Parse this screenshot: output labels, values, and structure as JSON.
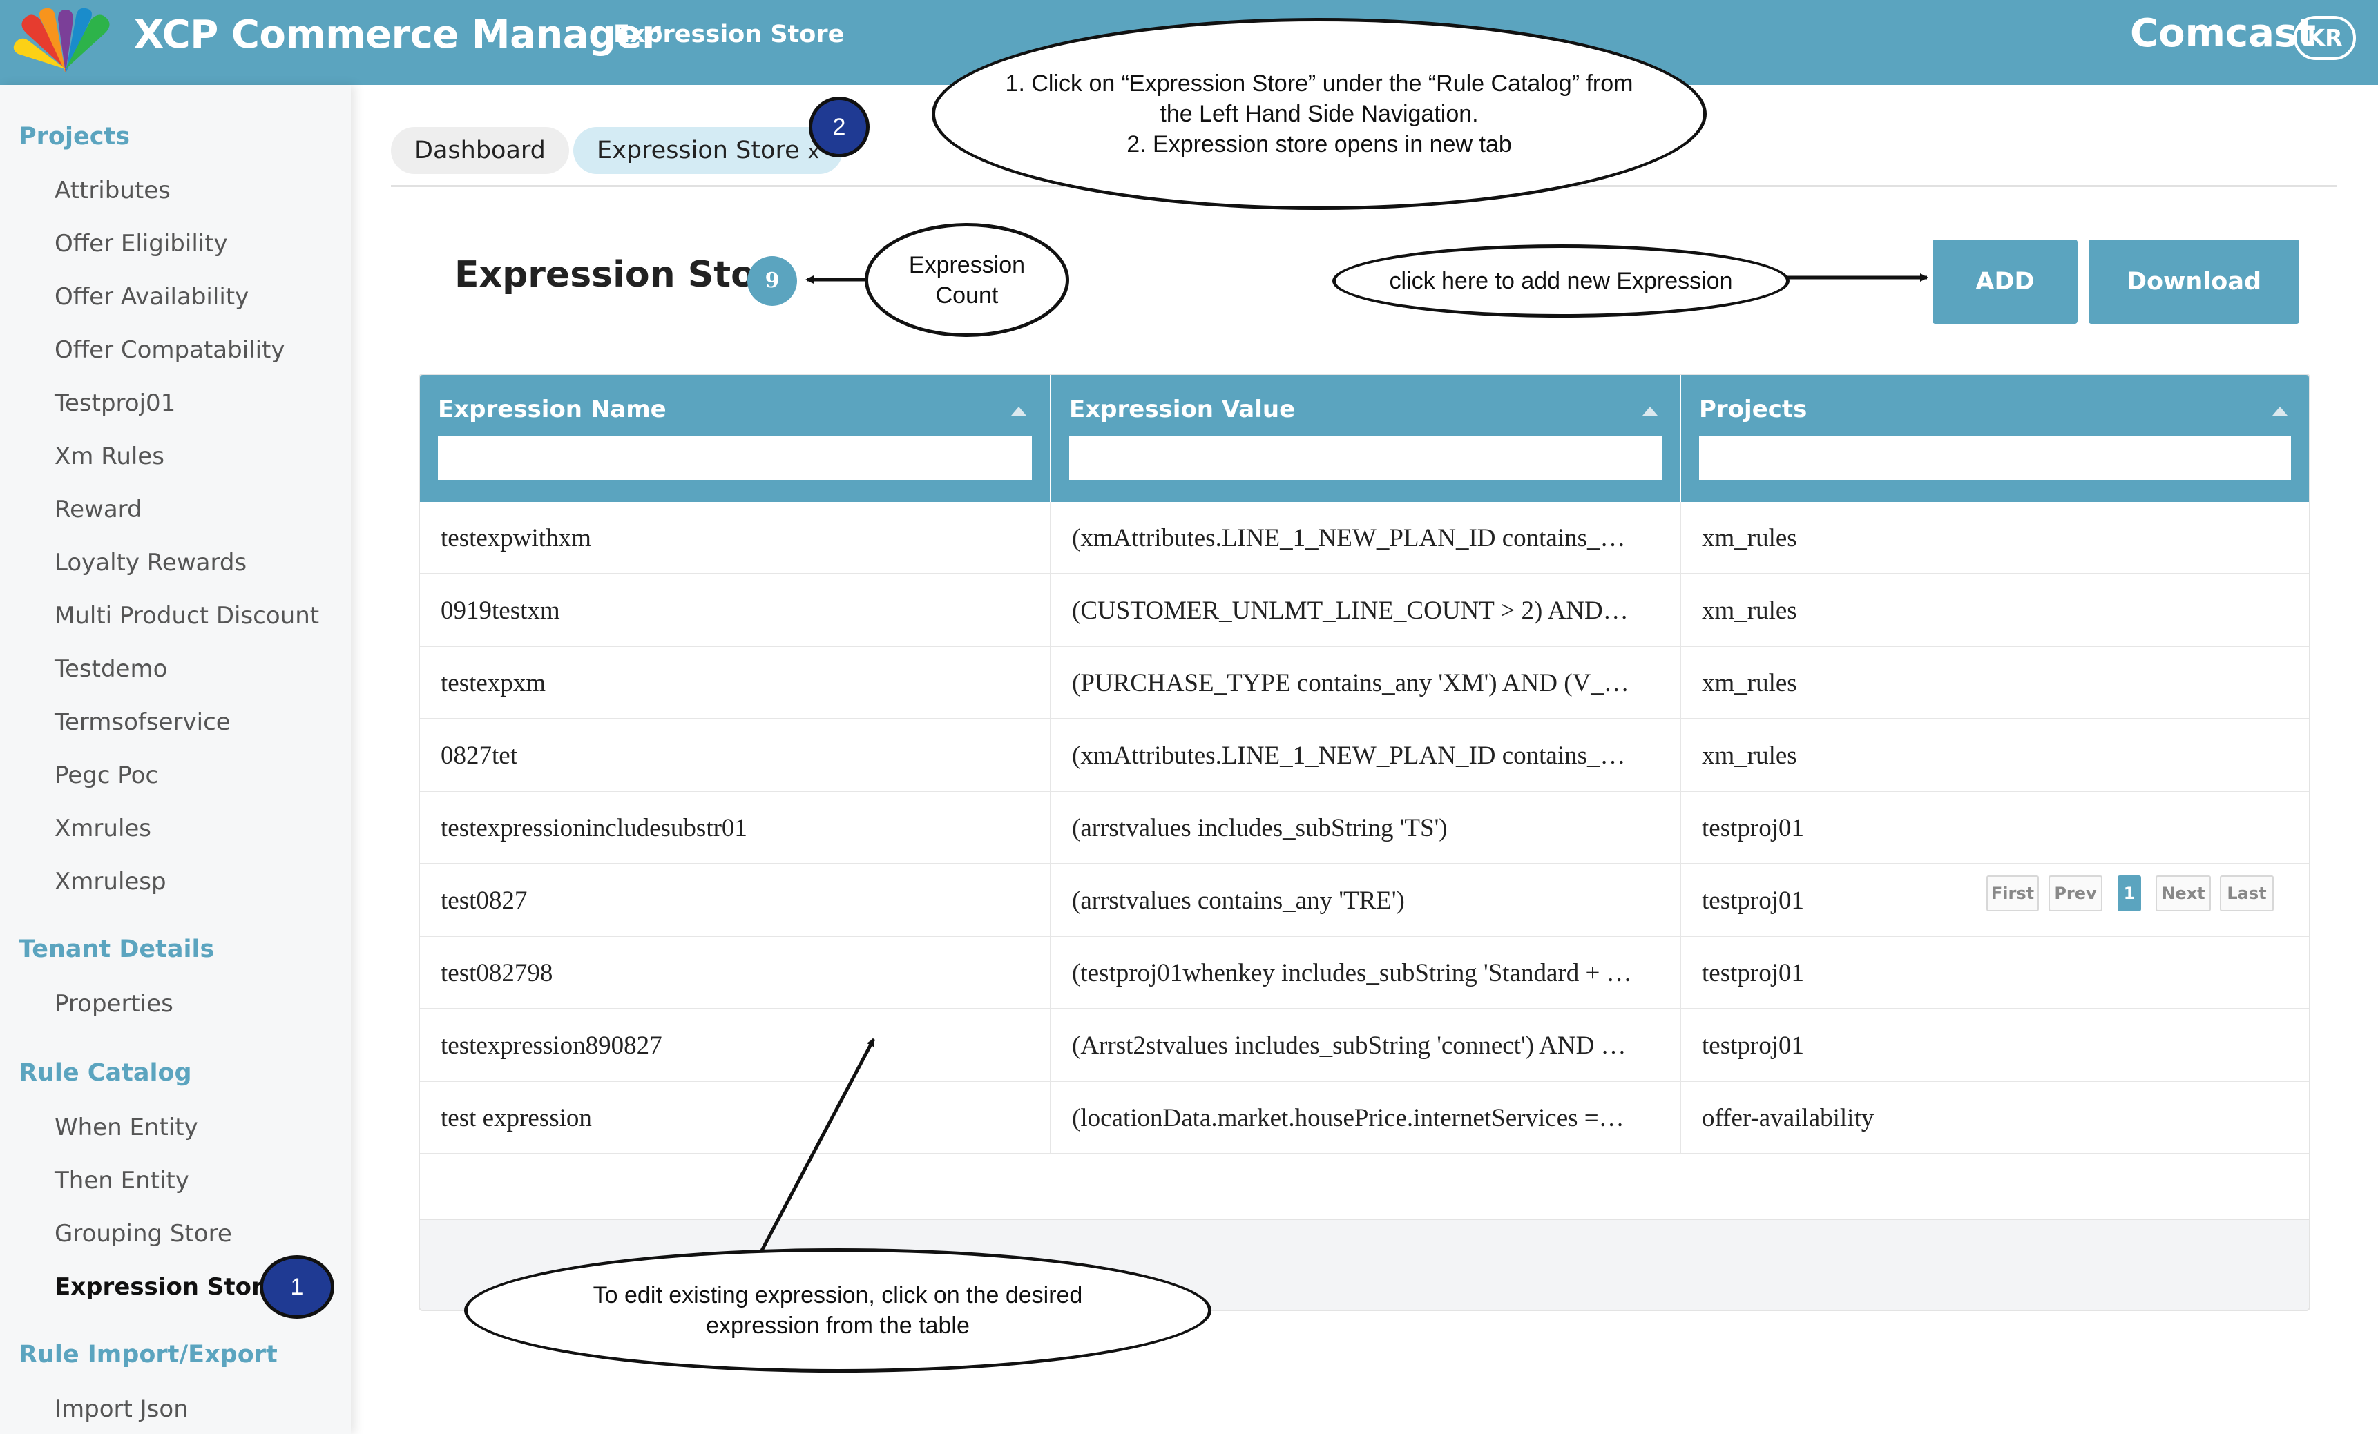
{
  "header": {
    "app_title": "XCP Commerce Manager",
    "active_section": "Expression Store",
    "brand": "Comcast",
    "user_initials": "KR",
    "logo_icon": "peacock-logo-icon"
  },
  "sidebar": {
    "sections": [
      {
        "title": "Projects",
        "items": [
          "Attributes",
          "Offer Eligibility",
          "Offer Availability",
          "Offer Compatability",
          "Testproj01",
          "Xm Rules",
          "Reward",
          "Loyalty Rewards",
          "Multi Product Discount",
          "Testdemo",
          "Termsofservice",
          "Pegc Poc",
          "Xmrules",
          "Xmrulesp"
        ]
      },
      {
        "title": "Tenant Details",
        "items": [
          "Properties"
        ]
      },
      {
        "title": "Rule Catalog",
        "items": [
          "When Entity",
          "Then Entity",
          "Grouping Store",
          "Expression Store"
        ]
      },
      {
        "title": "Rule Import/Export",
        "items": [
          "Import Json"
        ]
      }
    ],
    "active_item": "Expression Store"
  },
  "tabs": [
    {
      "label": "Dashboard"
    },
    {
      "label": "Expression Store",
      "close": "x"
    }
  ],
  "page": {
    "title": "Expression Store",
    "count": "9",
    "add_label": "ADD",
    "download_label": "Download"
  },
  "table": {
    "columns": [
      "Expression Name",
      "Expression Value",
      "Projects"
    ],
    "rows": [
      [
        "testexpwithxm",
        "(xmAttributes.LINE_1_NEW_PLAN_ID contains_…",
        "xm_rules"
      ],
      [
        "0919testxm",
        "(CUSTOMER_UNLMT_LINE_COUNT > 2) AND…",
        "xm_rules"
      ],
      [
        "testexpxm",
        "(PURCHASE_TYPE contains_any 'XM') AND (V_…",
        "xm_rules"
      ],
      [
        "0827tet",
        "(xmAttributes.LINE_1_NEW_PLAN_ID contains_…",
        "xm_rules"
      ],
      [
        "testexpressionincludesubstr01",
        "(arrstvalues includes_subString 'TS')",
        "testproj01"
      ],
      [
        "test0827",
        "(arrstvalues contains_any 'TRE')",
        "testproj01"
      ],
      [
        "test082798",
        "(testproj01whenkey includes_subString 'Standard + …",
        "testproj01"
      ],
      [
        "testexpression890827",
        "(Arrst2stvalues includes_subString 'connect') AND …",
        "testproj01"
      ],
      [
        "test expression",
        "(locationData.market.housePrice.internetServices =…",
        "offer-availability"
      ]
    ],
    "pagination": {
      "first": "First",
      "prev": "Prev",
      "current": "1",
      "next": "Next",
      "last": "Last"
    }
  },
  "annotations": {
    "step1_badge": "1",
    "step2_badge": "2",
    "callout_nav": "1. Click on “Expression Store” under the “Rule Catalog” from\nthe Left Hand Side Navigation.\n2. Expression store opens in new tab",
    "callout_count": "Expression\nCount",
    "callout_add": "click here to add new Expression",
    "callout_edit": "To edit existing expression, click on the desired\nexpression from the table"
  }
}
